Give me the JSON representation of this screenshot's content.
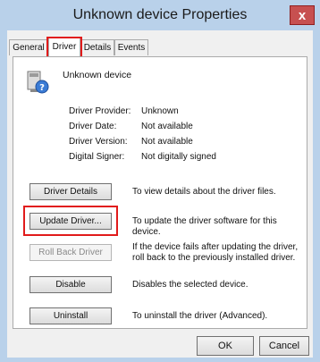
{
  "window": {
    "title": "Unknown device Properties",
    "close_glyph": "x"
  },
  "tabs": [
    {
      "label": "General",
      "active": false
    },
    {
      "label": "Driver",
      "active": true
    },
    {
      "label": "Details",
      "active": false
    },
    {
      "label": "Events",
      "active": false
    }
  ],
  "device": {
    "name": "Unknown device",
    "icon": "unknown-device-icon"
  },
  "properties": [
    {
      "label": "Driver Provider:",
      "value": "Unknown"
    },
    {
      "label": "Driver Date:",
      "value": "Not available"
    },
    {
      "label": "Driver Version:",
      "value": "Not available"
    },
    {
      "label": "Digital Signer:",
      "value": "Not digitally signed"
    }
  ],
  "actions": [
    {
      "label": "Driver Details",
      "description": "To view details about the driver files.",
      "enabled": true
    },
    {
      "label": "Update Driver...",
      "description": "To update the driver software for this device.",
      "enabled": true
    },
    {
      "label": "Roll Back Driver",
      "description": "If the device fails after updating the driver, roll back to the previously installed driver.",
      "enabled": false
    },
    {
      "label": "Disable",
      "description": "Disables the selected device.",
      "enabled": true
    },
    {
      "label": "Uninstall",
      "description": "To uninstall the driver (Advanced).",
      "enabled": true
    }
  ],
  "footer": {
    "ok_label": "OK",
    "cancel_label": "Cancel"
  },
  "colors": {
    "highlight": "#e11b1b",
    "titlebar": "#b9d1ea",
    "close": "#c75050"
  }
}
